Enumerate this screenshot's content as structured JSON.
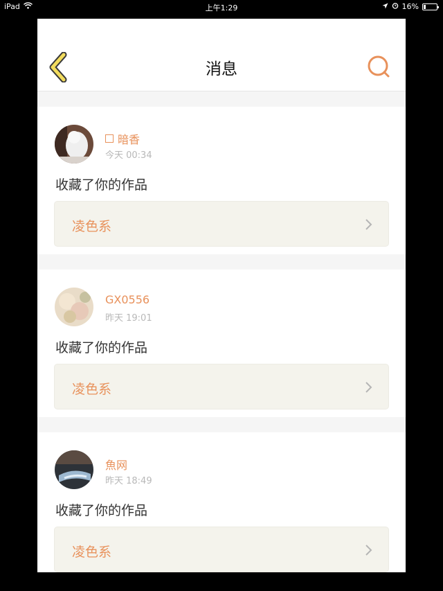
{
  "status_bar": {
    "device": "iPad",
    "time": "上午1:29",
    "battery": "16%",
    "battery_level": 0.16
  },
  "nav": {
    "title": "消息"
  },
  "messages": [
    {
      "user": "暗香",
      "time": "今天 00:34",
      "action": "收藏了你的作品",
      "work": "凌色系"
    },
    {
      "user": "GX0556",
      "time": "昨天 19:01",
      "action": "收藏了你的作品",
      "work": "凌色系"
    },
    {
      "user": "魚网",
      "time": "昨天 18:49",
      "action": "收藏了你的作品",
      "work": "凌色系"
    }
  ],
  "colors": {
    "accent": "#e8915b",
    "back_arrow_fill": "#f2dc5d",
    "card_bg": "#f4f3ec"
  }
}
